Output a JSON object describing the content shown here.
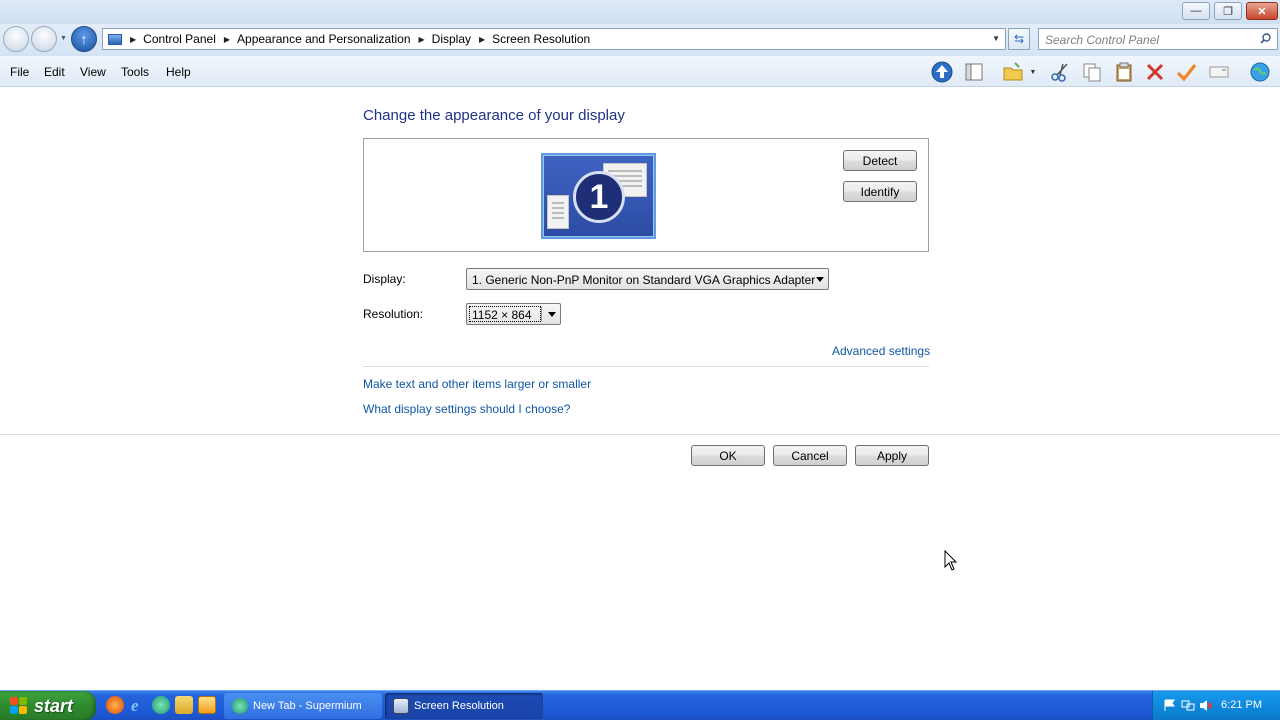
{
  "window": {
    "controls": {
      "minimize": "—",
      "maximize": "❐",
      "close": "✕"
    }
  },
  "address": {
    "breadcrumbs": [
      "Control Panel",
      "Appearance and Personalization",
      "Display",
      "Screen Resolution"
    ],
    "search_placeholder": "Search Control Panel"
  },
  "menu": {
    "items": [
      "File",
      "Edit",
      "View",
      "Tools",
      "Help"
    ]
  },
  "toolbar": {
    "icons": [
      "up-arrow-icon",
      "panel-icon",
      "folder-icon",
      "cut-icon",
      "copy-icon",
      "paste-icon",
      "delete-icon",
      "check-icon",
      "rename-icon",
      "globe-icon"
    ]
  },
  "content": {
    "title": "Change the appearance of your display",
    "monitor_number": "1",
    "detect_label": "Detect",
    "identify_label": "Identify",
    "display_label": "Display:",
    "display_value": "1. Generic Non-PnP Monitor on Standard VGA Graphics Adapter",
    "resolution_label": "Resolution:",
    "resolution_value": "1152 × 864",
    "advanced_link": "Advanced settings",
    "text_size_link": "Make text and other items larger or smaller",
    "help_link": "What display settings should I choose?",
    "ok_label": "OK",
    "cancel_label": "Cancel",
    "apply_label": "Apply"
  },
  "taskbar": {
    "start_label": "start",
    "quick_launch": [
      "firefox-icon",
      "ie-icon",
      "supermium-icon",
      "explorer-icon",
      "media-icon"
    ],
    "tasks": [
      {
        "label": "New Tab - Supermium",
        "active": false
      },
      {
        "label": "Screen Resolution",
        "active": true
      }
    ],
    "clock": "6:21 PM"
  },
  "colors": {
    "title_text": "#1e3287",
    "link": "#0f57a8",
    "taskbar": "#2464dd",
    "start": "#2f8a2f"
  }
}
